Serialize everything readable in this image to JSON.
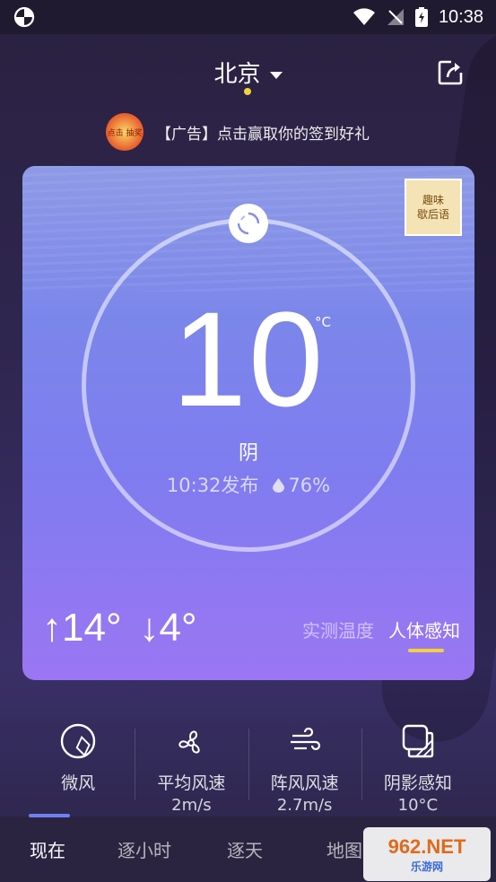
{
  "status_bar": {
    "time": "10:38"
  },
  "header": {
    "city": "北京"
  },
  "ad": {
    "badge_text": "点击 抽奖",
    "text": "【广告】点击赢取你的签到好礼"
  },
  "promo_tile": {
    "line1": "趣味",
    "line2": "歇后语"
  },
  "current": {
    "temperature": "10",
    "unit": "°C",
    "condition": "阴",
    "published": "10:32发布",
    "humidity": "76%",
    "high": "↑14°",
    "low": "↓4°"
  },
  "mode_tabs": {
    "measured": "实测温度",
    "feel": "人体感知"
  },
  "metrics": [
    {
      "icon": "compass-icon",
      "label": "微风",
      "value": ""
    },
    {
      "icon": "fan-icon",
      "label": "平均风速",
      "value": "2m/s"
    },
    {
      "icon": "wind-icon",
      "label": "阵风风速",
      "value": "2.7m/s"
    },
    {
      "icon": "shade-icon",
      "label": "阴影感知",
      "value": "10°C"
    }
  ],
  "nav": {
    "now": "现在",
    "hourly": "逐小时",
    "daily": "逐天",
    "map": "地图"
  },
  "watermark": {
    "main": "962.NET",
    "sub": "乐游网"
  },
  "colors": {
    "accent_yellow": "#f4d13c",
    "indicator_blue": "#6f7ff2"
  }
}
